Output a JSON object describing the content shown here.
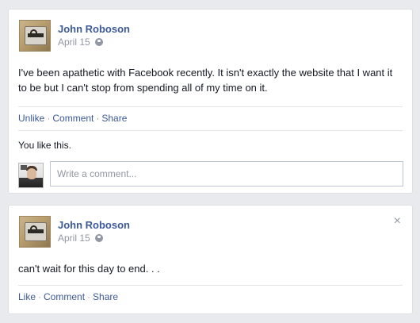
{
  "posts": [
    {
      "author": "John Roboson",
      "date": "April 15",
      "privacy_icon": "globe-icon",
      "text": "I've been apathetic with Facebook recently. It isn't exactly the website that I want it to be but I can't stop from spending all of my time on it.",
      "actions": [
        "Unlike",
        "Comment",
        "Share"
      ],
      "likes_text": "You like this.",
      "comment_placeholder": "Write a comment..."
    },
    {
      "author": "John Roboson",
      "date": "April 15",
      "privacy_icon": "globe-icon",
      "close_icon": "×",
      "text": "can't wait for this day to end. . .",
      "actions": [
        "Like",
        "Comment",
        "Share"
      ]
    }
  ],
  "colors": {
    "page_background": "#e9eaed",
    "link": "#3b5998",
    "meta": "#9197a3"
  }
}
